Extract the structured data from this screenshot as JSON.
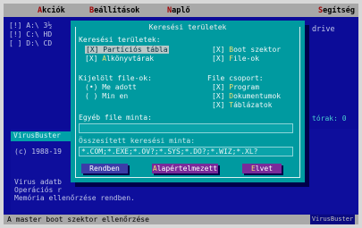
{
  "menubar": {
    "items": [
      {
        "hotkey": "",
        "label": "kciók"
      },
      {
        "hotkey": "",
        "label": "eállítások"
      },
      {
        "hotkey": "",
        "label": "aplő"
      },
      {
        "hotkey": "",
        "label": "egítség"
      }
    ]
  },
  "background": {
    "line1": "[!] A:\\  3½",
    "line2": "[!] C:\\  HD",
    "line3": "[ ] D:\\  CD",
    "drive_label": "drive",
    "count_label": "tórak: 0",
    "panel_title": "VirusBuster",
    "copyright": "(c) 1988-19",
    "info1": "Virus adatb",
    "info2": "Operációs r",
    "info3": "Memória ellenőrzése rendben."
  },
  "statusbar": {
    "text": "A master boot szektor ellenőrzése",
    "right": "VirusBuster"
  },
  "dialog": {
    "title": "Keresési területek",
    "areas_label": "Keresési területek:",
    "areas": [
      {
        "mark": "[X]",
        "label": "Partíciós tábla",
        "selected": true
      },
      {
        "mark": "[X]",
        "label": "oot szektor",
        "selected": false
      },
      {
        "mark": "[X]",
        "label": "lkönyvtárak",
        "selected": false
      },
      {
        "mark": "[X]",
        "label": "ile-ok",
        "selected": false
      }
    ],
    "selected_files_label": "Kijelölt file-ok:",
    "file_options": [
      {
        "mark": "(•)",
        "label": "Me adott"
      },
      {
        "mark": "( )",
        "label": "Min en"
      }
    ],
    "file_group_label": "File csoport:",
    "file_groups": [
      {
        "mark": "[X]",
        "label": "rogram"
      },
      {
        "mark": "[X]",
        "label": "okumentumok"
      },
      {
        "mark": "[X]",
        "label": "áblázatok"
      }
    ],
    "other_files_label": "Egyéb file minta:",
    "other_files_value": "",
    "combined_label": "Összesített keresési minta:",
    "combined_value": "*.COM;*.EXE;*.OV?;*.SYS;*.DO?;*.WIZ;*.XL?",
    "buttons": {
      "ok": "Rendben",
      "default": "lapértelmezett",
      "cancel": "lvet"
    }
  }
}
